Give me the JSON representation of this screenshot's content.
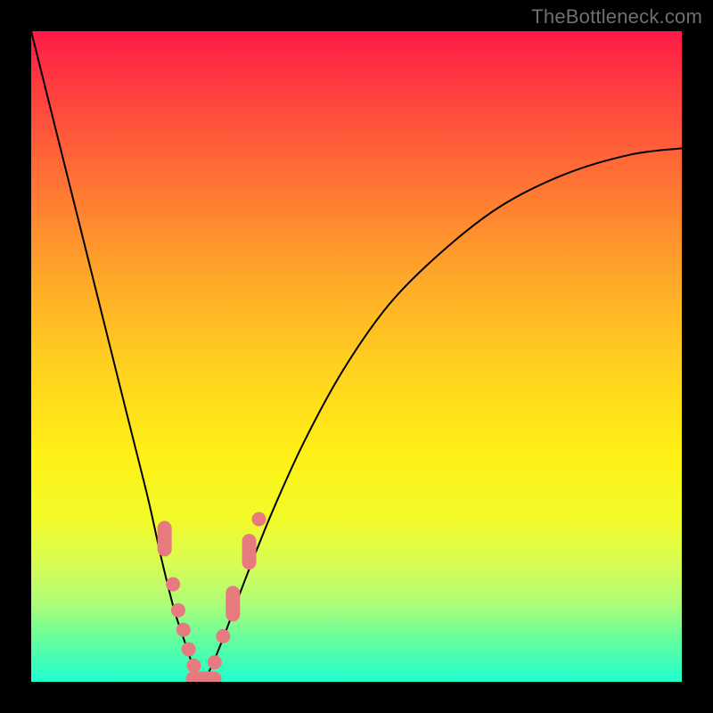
{
  "watermark": "TheBottleneck.com",
  "gradient": {
    "top": "#ff1a47",
    "mid": "#fff016",
    "bottom": "#1effce"
  },
  "curve": {
    "stroke": "#000000",
    "stroke_width": 2
  },
  "marker": {
    "fill": "#e77a7f",
    "r_dot": 8,
    "r_pill_w": 16,
    "r_pill_h": 40
  },
  "chart_data": {
    "type": "line",
    "title": "",
    "xlabel": "",
    "ylabel": "",
    "xlim": [
      0,
      100
    ],
    "ylim": [
      0,
      100
    ],
    "x": [
      0,
      3,
      6,
      9,
      12,
      15,
      18,
      20,
      22,
      24,
      25,
      26,
      27,
      28,
      30,
      33,
      37,
      42,
      48,
      55,
      63,
      72,
      82,
      92,
      100
    ],
    "values": [
      100,
      88,
      76,
      64,
      52,
      40,
      28,
      19,
      11,
      5,
      2,
      0,
      1,
      3,
      8,
      16,
      26,
      37,
      48,
      58,
      66,
      73,
      78,
      81,
      82
    ],
    "marker_points": [
      {
        "x": 20.5,
        "y": 22.0,
        "kind": "pill"
      },
      {
        "x": 21.8,
        "y": 15.0,
        "kind": "dot"
      },
      {
        "x": 22.6,
        "y": 11.0,
        "kind": "dot"
      },
      {
        "x": 23.4,
        "y": 8.0,
        "kind": "dot"
      },
      {
        "x": 24.2,
        "y": 5.0,
        "kind": "dot"
      },
      {
        "x": 25.0,
        "y": 2.5,
        "kind": "dot"
      },
      {
        "x": 26.5,
        "y": 0.5,
        "kind": "pill_h"
      },
      {
        "x": 28.2,
        "y": 3.0,
        "kind": "dot"
      },
      {
        "x": 29.5,
        "y": 7.0,
        "kind": "dot"
      },
      {
        "x": 31.0,
        "y": 12.0,
        "kind": "pill"
      },
      {
        "x": 33.5,
        "y": 20.0,
        "kind": "pill"
      },
      {
        "x": 35.0,
        "y": 25.0,
        "kind": "dot"
      }
    ]
  }
}
